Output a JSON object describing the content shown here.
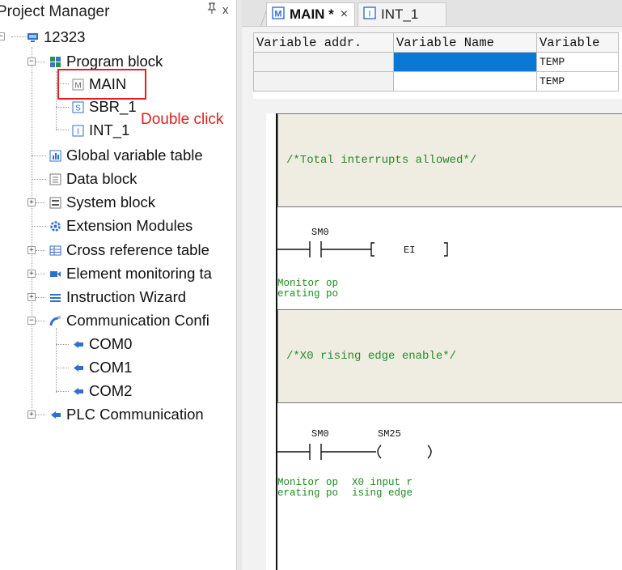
{
  "project_manager": {
    "title": "Project Manager",
    "pin_icon": "pin-icon",
    "close_glyph": "x",
    "tree": [
      {
        "id": "root",
        "label": "12323",
        "icon": "computer-icon"
      },
      {
        "id": "program-block",
        "label": "Program block",
        "icon": "program-block-icon"
      },
      {
        "id": "main",
        "label": "MAIN",
        "icon": "main-program-icon"
      },
      {
        "id": "sbr1",
        "label": "SBR_1",
        "icon": "subroutine-icon"
      },
      {
        "id": "int1",
        "label": "INT_1",
        "icon": "interrupt-icon"
      },
      {
        "id": "global-var",
        "label": "Global variable table",
        "icon": "table-icon"
      },
      {
        "id": "data-block",
        "label": "Data block",
        "icon": "data-block-icon"
      },
      {
        "id": "system-block",
        "label": "System block",
        "icon": "system-block-icon"
      },
      {
        "id": "ext-modules",
        "label": "Extension Modules",
        "icon": "gear-icon"
      },
      {
        "id": "cross-ref",
        "label": "Cross reference table",
        "icon": "grid-icon"
      },
      {
        "id": "elem-monitor",
        "label": "Element monitoring ta",
        "icon": "camera-icon"
      },
      {
        "id": "instr-wizard",
        "label": "Instruction Wizard",
        "icon": "list-icon"
      },
      {
        "id": "comm-config",
        "label": "Communication Confi",
        "icon": "satellite-icon"
      },
      {
        "id": "com0",
        "label": "COM0",
        "icon": "port-icon"
      },
      {
        "id": "com1",
        "label": "COM1",
        "icon": "port-icon"
      },
      {
        "id": "com2",
        "label": "COM2",
        "icon": "port-icon"
      },
      {
        "id": "plc-comm",
        "label": "PLC Communication",
        "icon": "port-icon"
      }
    ],
    "annotation": "Double click",
    "highlight_color": "#e02020"
  },
  "tabs": [
    {
      "label": "MAIN *",
      "close": "×",
      "icon": "main-program-icon"
    },
    {
      "label": "INT_1",
      "icon": "interrupt-icon"
    }
  ],
  "variable_table": {
    "headers": [
      "Variable addr.",
      "Variable Name",
      "Variable"
    ],
    "rows": [
      [
        "",
        "",
        "TEMP"
      ],
      [
        "",
        "",
        "TEMP"
      ]
    ],
    "selected_color": "#0a78d7"
  },
  "ladder": {
    "networks": [
      {
        "comment": "/*Total interrupts allowed*/",
        "contact_label": "SM0",
        "coil_instruction": "EI",
        "contact_desc": [
          "Monitor op",
          "erating po"
        ]
      },
      {
        "comment": "/*X0 rising edge enable*/",
        "contact_label": "SM0",
        "coil_label": "SM25",
        "contact_desc": [
          "Monitor op",
          "erating po"
        ],
        "coil_desc": [
          "X0 input r",
          "ising edge"
        ]
      }
    ]
  }
}
